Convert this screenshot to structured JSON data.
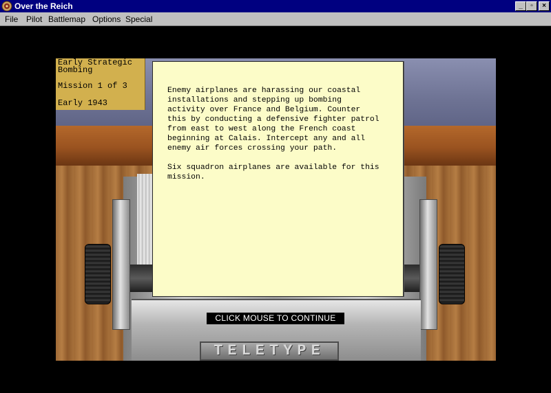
{
  "window": {
    "title": "Over the Reich",
    "controls": {
      "minimize": "_",
      "maximize": "▫",
      "close": "×"
    }
  },
  "menu": [
    "File",
    "Pilot",
    "Battlemap",
    "Options",
    "Special"
  ],
  "mission_info": {
    "campaign_line1": "Early Strategic",
    "campaign_line2": "Bombing",
    "mission": "Mission 1 of 3",
    "date": "Early 1943"
  },
  "briefing": {
    "paragraph1": "Enemy airplanes are harassing our coastal\ninstallations and stepping up bombing\nactivity over France and Belgium. Counter\nthis by conducting a defensive fighter patrol\nfrom east to west along the French coast\nbeginning at Calais. Intercept any and all\nenemy air forces crossing your path.",
    "paragraph2": "Six squadron airplanes are available for this\nmission."
  },
  "continue_prompt": "CLICK MOUSE TO CONTINUE",
  "machine_label": "TELETYPE",
  "icons": {
    "app": "app-emblem-icon"
  }
}
